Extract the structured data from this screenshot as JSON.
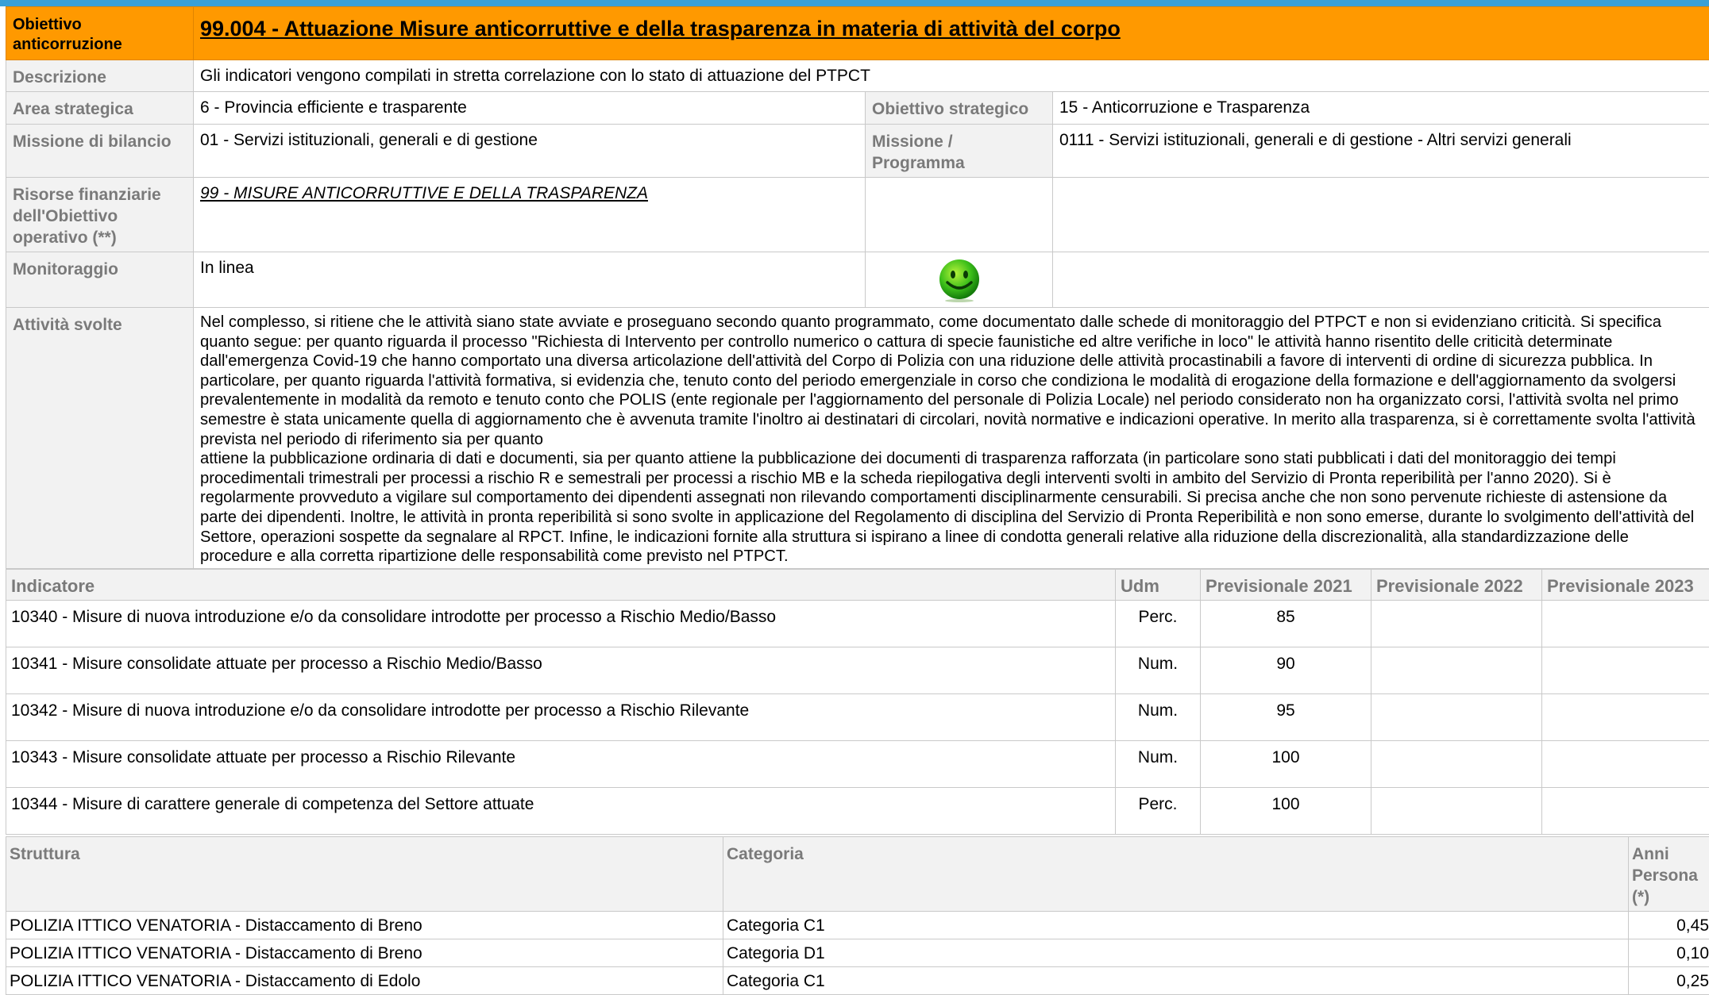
{
  "header": {
    "label": "Obiettivo anticorruzione",
    "title": "99.004 - Attuazione Misure anticorruttive e della trasparenza in materia di attività del corpo",
    "color": "#ff9900"
  },
  "details": {
    "descrizione_label": "Descrizione",
    "descrizione_value": "Gli indicatori vengono compilati in stretta correlazione con lo stato di attuazione del PTPCT",
    "area_label": "Area strategica",
    "area_value": "6 - Provincia efficiente e trasparente",
    "obiettivo_strategico_label": "Obiettivo strategico",
    "obiettivo_strategico_value": "15 - Anticorruzione e Trasparenza",
    "missione_label": "Missione di bilancio",
    "missione_value": "01 - Servizi istituzionali, generali e di gestione",
    "programma_label": "Missione / Programma",
    "programma_value": "0111 - Servizi istituzionali, generali e di gestione - Altri servizi generali",
    "risorse_label": "Risorse finanziarie dell'Obiettivo operativo (**)",
    "risorse_value": "99 - MISURE ANTICORRUTTIVE E DELLA TRASPARENZA",
    "monitoraggio_label": "Monitoraggio",
    "monitoraggio_value": "In linea",
    "monitoraggio_icon": "smiley-icon"
  },
  "attivita": {
    "label": "Attività svolte",
    "text": "Nel complesso, si ritiene che le attività siano state avviate e proseguano secondo quanto programmato, come documentato dalle schede di monitoraggio del PTPCT e non si evidenziano criticità. Si specifica quanto segue: per quanto riguarda il processo \"Richiesta di Intervento per controllo numerico o cattura di specie faunistiche ed altre verifiche in loco\" le attività hanno risentito delle criticità determinate dall'emergenza Covid-19 che hanno comportato una diversa articolazione dell'attività del Corpo di Polizia con una riduzione delle attività procastinabili a favore di interventi di ordine di sicurezza pubblica. In particolare, per quanto riguarda l'attività formativa, si evidenzia che, tenuto conto del periodo emergenziale in corso che condiziona le modalità di erogazione della formazione e dell'aggiornamento da svolgersi prevalentemente in modalità da remoto e tenuto conto che POLIS (ente regionale per l'aggiornamento del personale di Polizia Locale) nel periodo considerato non ha organizzato corsi, l'attività svolta nel primo semestre è stata unicamente quella di aggiornamento che è avvenuta tramite l'inoltro ai destinatari di circolari, novità normative e indicazioni operative. In merito alla trasparenza, si è correttamente svolta l'attività prevista nel periodo di riferimento sia per quanto\nattiene la pubblicazione ordinaria di dati e documenti, sia per quanto attiene la pubblicazione dei documenti di trasparenza rafforzata (in particolare sono stati pubblicati i dati del monitoraggio dei tempi procedimentali trimestrali per processi a rischio R e semestrali per processi a rischio MB e la scheda riepilogativa degli interventi svolti in ambito del Servizio di Pronta reperibilità per l'anno 2020). Si è regolarmente provveduto a vigilare sul comportamento dei dipendenti assegnati non rilevando comportamenti disciplinarmente censurabili. Si precisa anche che non sono pervenute richieste di astensione da parte dei dipendenti. Inoltre, le attività in pronta reperibilità si sono svolte in applicazione del Regolamento di disciplina del Servizio di Pronta Reperibilità e non sono emerse, durante lo svolgimento dell'attività del Settore, operazioni sospette da segnalare al RPCT. Infine, le indicazioni fornite alla struttura si ispirano a linee di condotta generali relative alla riduzione della discrezionalità, alla standardizzazione delle procedure e alla corretta ripartizione delle responsabilità come previsto nel PTPCT."
  },
  "indicatori": {
    "headers": [
      "Indicatore",
      "Udm",
      "Previsionale 2021",
      "Previsionale 2022",
      "Previsionale 2023"
    ],
    "rows": [
      {
        "name": "10340 - Misure di nuova introduzione e/o da consolidare introdotte per processo a Rischio Medio/Basso",
        "udm": "Perc.",
        "p2021": "85",
        "p2022": "",
        "p2023": ""
      },
      {
        "name": "10341 - Misure consolidate attuate per processo a Rischio Medio/Basso",
        "udm": "Num.",
        "p2021": "90",
        "p2022": "",
        "p2023": ""
      },
      {
        "name": "10342 - Misure di nuova introduzione e/o da consolidare introdotte per processo a Rischio Rilevante",
        "udm": "Num.",
        "p2021": "95",
        "p2022": "",
        "p2023": ""
      },
      {
        "name": "10343 - Misure consolidate attuate per processo a Rischio Rilevante",
        "udm": "Num.",
        "p2021": "100",
        "p2022": "",
        "p2023": ""
      },
      {
        "name": "10344 - Misure di carattere generale di competenza del Settore attuate",
        "udm": "Perc.",
        "p2021": "100",
        "p2022": "",
        "p2023": ""
      }
    ]
  },
  "struttura": {
    "headers": [
      "Struttura",
      "Categoria",
      "Anni Persona (*)"
    ],
    "rows": [
      {
        "struttura": "POLIZIA  ITTICO VENATORIA - Distaccamento di Breno",
        "categoria": "Categoria C1",
        "anni": "0,45"
      },
      {
        "struttura": "POLIZIA  ITTICO VENATORIA - Distaccamento di Breno",
        "categoria": "Categoria D1",
        "anni": "0,10"
      },
      {
        "struttura": "POLIZIA  ITTICO VENATORIA - Distaccamento di Edolo",
        "categoria": "Categoria C1",
        "anni": "0,25"
      }
    ]
  }
}
